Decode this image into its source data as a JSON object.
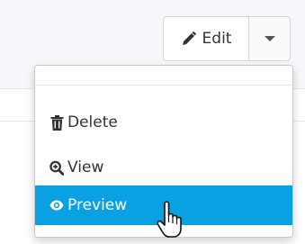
{
  "toolbar": {
    "edit_label": "Edit",
    "edit_icon": "pencil-icon",
    "caret_icon": "caret-down-icon"
  },
  "menu": {
    "items": [
      {
        "label": "Delete",
        "icon": "trash-icon",
        "state": "normal"
      },
      {
        "label": "View",
        "icon": "zoom-in-icon",
        "state": "normal"
      },
      {
        "label": "Preview",
        "icon": "eye-icon",
        "state": "highlighted"
      }
    ]
  },
  "pointer": {
    "icon": "hand-cursor-icon"
  },
  "colors": {
    "highlight": "#0aa1e2",
    "text": "#333333",
    "border": "#d6d6d6"
  }
}
